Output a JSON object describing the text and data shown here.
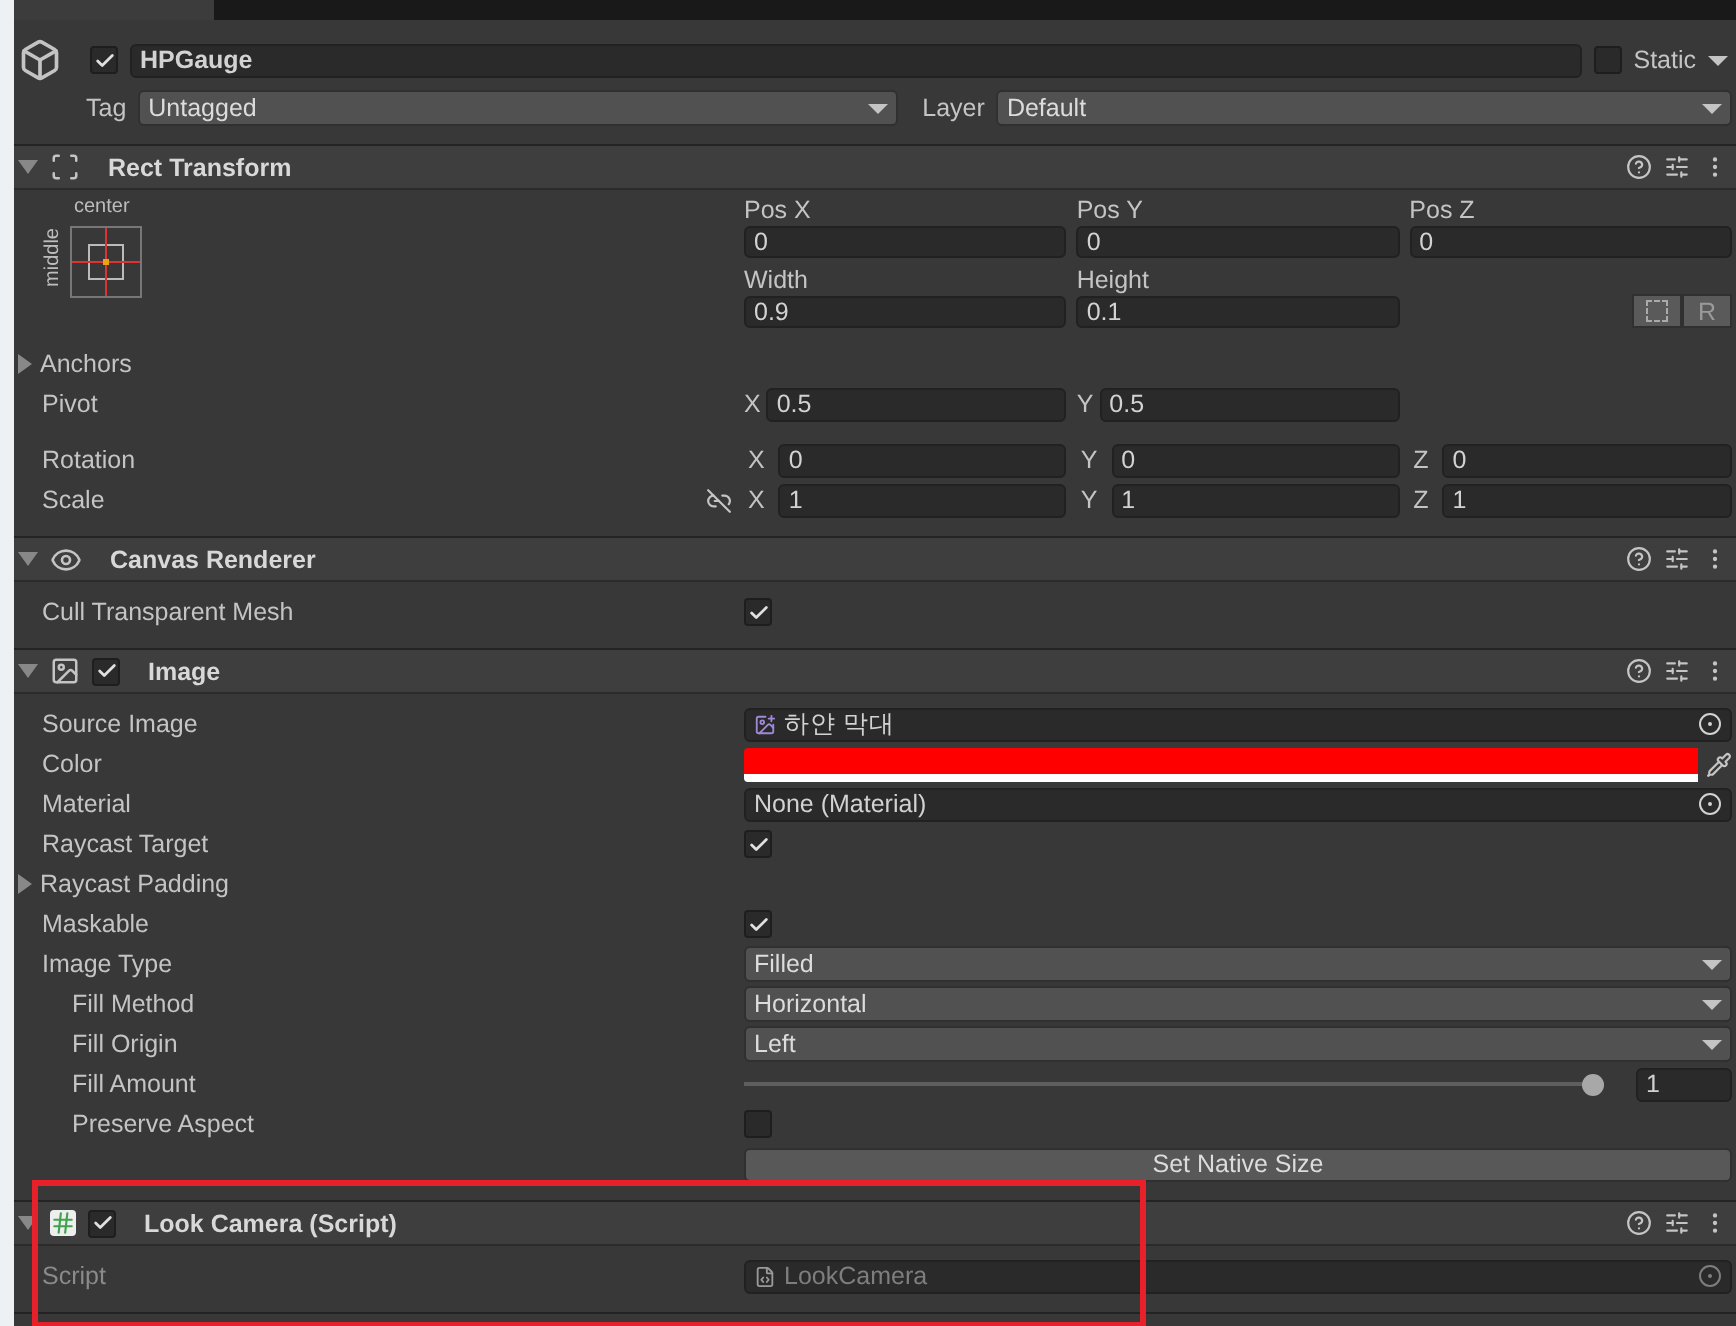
{
  "inspector": {
    "object": {
      "active": true,
      "name": "HPGauge",
      "static_label": "Static",
      "static": false,
      "tag_label": "Tag",
      "tag": "Untagged",
      "layer_label": "Layer",
      "layer": "Default"
    },
    "components": [
      {
        "kind": "rect_transform",
        "title": "Rect Transform",
        "expanded": true,
        "highlighted": false,
        "anchor_preset": {
          "horizontal": "center",
          "vertical": "middle"
        },
        "position_fields": [
          {
            "label": "Pos X",
            "value": "0"
          },
          {
            "label": "Pos Y",
            "value": "0"
          },
          {
            "label": "Pos Z",
            "value": "0"
          }
        ],
        "size_fields": [
          {
            "label": "Width",
            "value": "0.9"
          },
          {
            "label": "Height",
            "value": "0.1"
          }
        ],
        "raw_button": "R",
        "anchors": {
          "label": "Anchors",
          "expanded": false
        },
        "vectors": [
          {
            "label": "Pivot",
            "kind": "pivot",
            "axes": [
              {
                "axis": "X",
                "value": "0.5"
              },
              {
                "axis": "Y",
                "value": "0.5"
              }
            ]
          },
          {
            "label": "Rotation",
            "kind": "euler",
            "axes": [
              {
                "axis": "X",
                "value": "0"
              },
              {
                "axis": "Y",
                "value": "0"
              },
              {
                "axis": "Z",
                "value": "0"
              }
            ]
          },
          {
            "label": "Scale",
            "kind": "scale",
            "proportions_locked": false,
            "axes": [
              {
                "axis": "X",
                "value": "1"
              },
              {
                "axis": "Y",
                "value": "1"
              },
              {
                "axis": "Z",
                "value": "1"
              }
            ]
          }
        ]
      },
      {
        "kind": "canvas_renderer",
        "title": "Canvas Renderer",
        "expanded": true,
        "highlighted": false,
        "properties": [
          {
            "kind": "toggle",
            "label": "Cull Transparent Mesh",
            "checked": true
          }
        ]
      },
      {
        "kind": "image",
        "title": "Image",
        "enabled": true,
        "expanded": true,
        "highlighted": false,
        "properties": [
          {
            "kind": "object",
            "label": "Source Image",
            "value": "하얀 막대",
            "asset_icon": true
          },
          {
            "kind": "color",
            "label": "Color",
            "color": "#ff0000"
          },
          {
            "kind": "object",
            "label": "Material",
            "value": "None (Material)",
            "asset_icon": false
          },
          {
            "kind": "toggle",
            "label": "Raycast Target",
            "checked": true
          },
          {
            "kind": "foldout",
            "label": "Raycast Padding",
            "expanded": false
          },
          {
            "kind": "toggle",
            "label": "Maskable",
            "checked": true
          },
          {
            "kind": "dropdown",
            "label": "Image Type",
            "value": "Filled",
            "children": [
              {
                "kind": "dropdown",
                "label": "Fill Method",
                "value": "Horizontal"
              },
              {
                "kind": "dropdown",
                "label": "Fill Origin",
                "value": "Left"
              },
              {
                "kind": "slider",
                "label": "Fill Amount",
                "level": 1,
                "reading": "1"
              },
              {
                "kind": "toggle",
                "label": "Preserve Aspect",
                "checked": false
              }
            ]
          },
          {
            "kind": "button",
            "label": "Set Native Size"
          }
        ]
      },
      {
        "kind": "script",
        "title": "Look Camera (Script)",
        "enabled": true,
        "expanded": true,
        "highlighted": true,
        "properties": [
          {
            "kind": "object",
            "label": "Script",
            "value": "LookCamera",
            "asset_icon": true,
            "disabled": true
          }
        ]
      }
    ]
  }
}
